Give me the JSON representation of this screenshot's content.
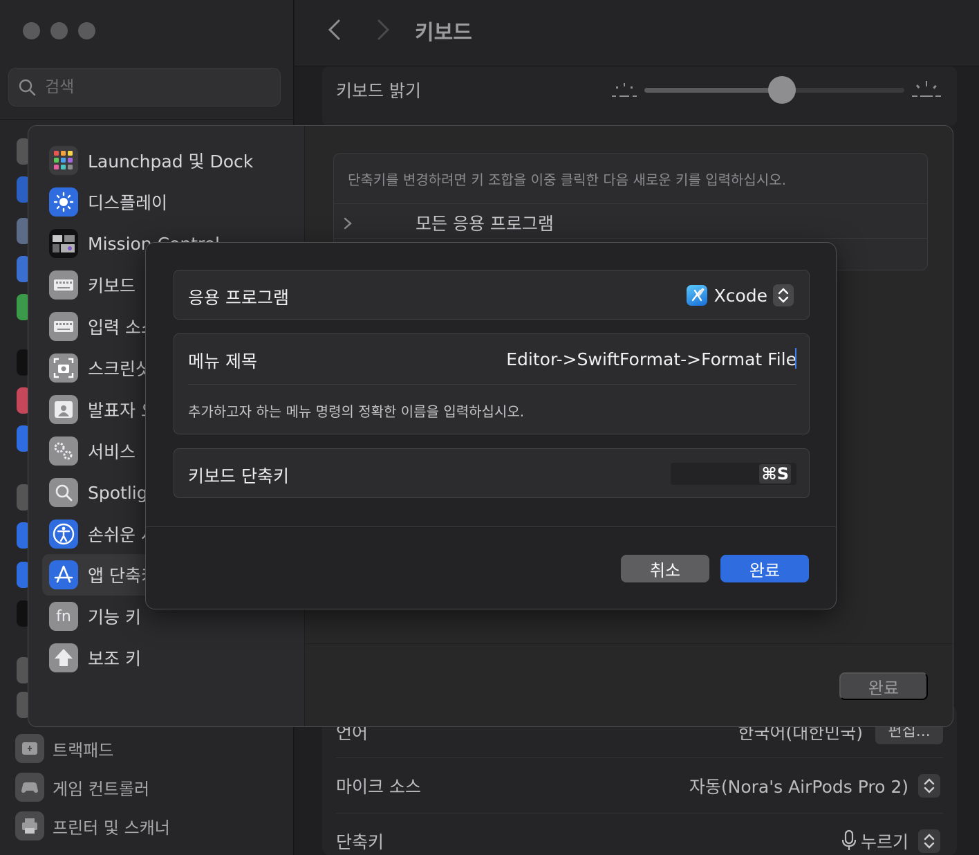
{
  "window": {
    "title": "키보드",
    "search_placeholder": "검색"
  },
  "base_sidebar": {
    "items": [
      {
        "label": "트랙패드",
        "icon": "trackpad-icon"
      },
      {
        "label": "게임 컨트롤러",
        "icon": "gamepad-icon"
      },
      {
        "label": "프린터 및 스캐너",
        "icon": "printer-icon"
      }
    ]
  },
  "base_main": {
    "brightness_label": "키보드 밝기",
    "brightness_level": 0.53,
    "language_label": "언어",
    "language_value": "한국어(대한민국)",
    "language_edit": "편집...",
    "mic_label": "마이크 소스",
    "mic_value": "자동(Nora's AirPods Pro 2)",
    "shortcut_label": "단축키",
    "shortcut_value": "누르기"
  },
  "sheet": {
    "sidebar": [
      {
        "label": "Launchpad 및 Dock",
        "icon": "launchpad-icon"
      },
      {
        "label": "디스플레이",
        "icon": "display-icon"
      },
      {
        "label": "Mission Control",
        "icon": "mission-control-icon"
      },
      {
        "label": "키보드",
        "icon": "keyboard-icon"
      },
      {
        "label": "입력 소스",
        "icon": "input-source-icon"
      },
      {
        "label": "스크린샷",
        "icon": "screenshot-icon"
      },
      {
        "label": "발표자 오버레이",
        "icon": "presenter-icon"
      },
      {
        "label": "서비스",
        "icon": "services-icon"
      },
      {
        "label": "Spotlight",
        "icon": "spotlight-icon"
      },
      {
        "label": "손쉬운 사용",
        "icon": "accessibility-icon"
      },
      {
        "label": "앱 단축키",
        "icon": "app-shortcuts-icon"
      },
      {
        "label": "기능 키",
        "icon": "fn-icon"
      },
      {
        "label": "보조 키",
        "icon": "modifier-icon"
      }
    ],
    "hint": "단축키를 변경하려면 키 조합을 이중 클릭한 다음 새로운 키를 입력하십시오.",
    "all_apps": "모든 응용 프로그램",
    "done_label": "완료"
  },
  "dialog": {
    "app_label": "응용 프로그램",
    "app_value": "Xcode",
    "menu_title_label": "메뉴 제목",
    "menu_title_value": "Editor->SwiftFormat->Format File",
    "menu_help": "추가하고자 하는 메뉴 명령의 정확한 이름을 입력하십시오.",
    "shortcut_label": "키보드 단축키",
    "shortcut_value": "⌘S",
    "cancel_label": "취소",
    "done_label": "완료"
  },
  "colors": {
    "accent": "#2f6ce0",
    "background": "#1f1f21"
  }
}
